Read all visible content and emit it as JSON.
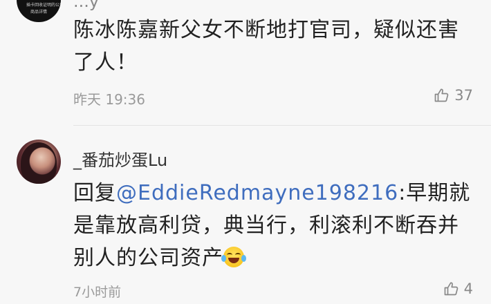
{
  "comments": [
    {
      "username_partial": "...y",
      "avatar_text": [
        "插卡回收证明的公司",
        "商品详情"
      ],
      "text": "陈冰陈嘉新父女不断地打官司，疑似还害了人！",
      "time": "昨天 19:36",
      "likes": "37",
      "icon": "thumbs-up-icon"
    },
    {
      "username": "_番茄炒蛋Lu",
      "reply_prefix": "回复",
      "mention": "@EddieRedmayne198216",
      "text": ":早期就是靠放高利贷，典当行，利滚利不断吞并别人的公司资产",
      "emoji": "laughing-tears-emoji",
      "time": "7小时前",
      "likes": "4",
      "icon": "thumbs-up-icon"
    }
  ],
  "colors": {
    "background": "#f7f7f7",
    "text": "#222222",
    "mention": "#3f6dbe",
    "meta": "#9a9a9a"
  }
}
